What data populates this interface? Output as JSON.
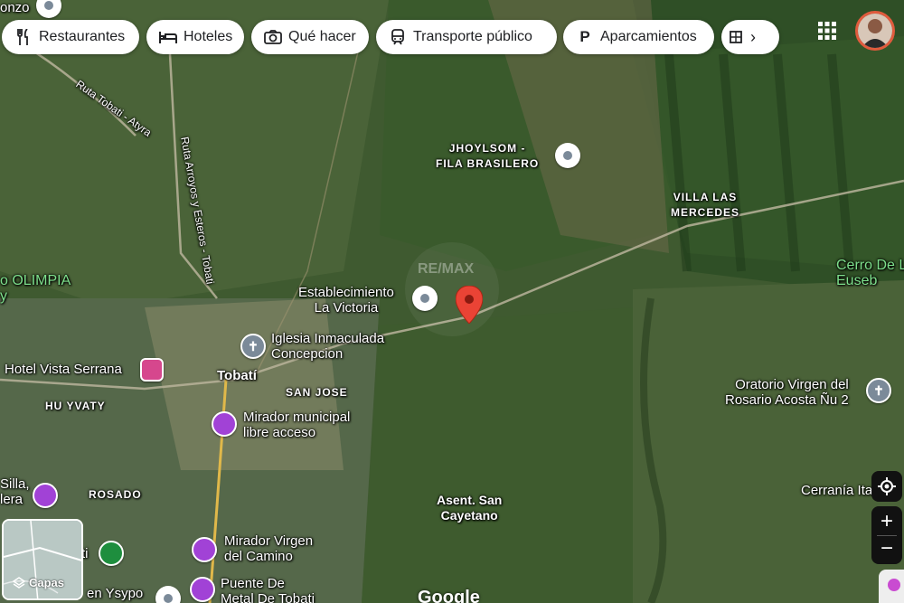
{
  "chips": [
    {
      "label": "Restaurantes",
      "icon": "fork-knife-icon"
    },
    {
      "label": "Hoteles",
      "icon": "bed-icon"
    },
    {
      "label": "Qué hacer",
      "icon": "camera-icon"
    },
    {
      "label": "Transporte público",
      "icon": "train-icon"
    },
    {
      "label": "Aparcamientos",
      "icon": "parking-icon"
    }
  ],
  "top_cut_label": "onzo",
  "labels": {
    "jhoylsom": "JHOYLSOM -\nFILA BRASILERO",
    "villa_las_mercedes": "VILLA LAS\nMERCEDES",
    "cerro": "Cerro De L\nEuseb",
    "olimpia": "o OLIMPIA\ny",
    "establecimiento": "Establecimiento\nLa Victoria",
    "iglesia": "Iglesia Inmaculada\nConcepcion",
    "hotel": "Hotel Vista Serrana",
    "tobati": "Tobatí",
    "san_jose": "SAN JOSE",
    "hu_yvaty": "HU YVATY",
    "mirador_municipal": "Mirador municipal\nlibre acceso",
    "oratorio": "Oratorio Virgen del\nRosario Acosta Ñu 2",
    "silla": "Silla,\nlera",
    "rosado": "ROSADO",
    "asent": "Asent. San\nCayetano",
    "cerrania": "Cerranía Ita",
    "mirador_virgen": "Mirador Virgen\ndel Camino",
    "puente": "Puente De\nMetal De Tobati",
    "en_ysypo": "en Ysypo",
    "ti": "ti",
    "road_tobati_atyra": "Ruta Tobati - Atyra",
    "road_arroyos": "Ruta Arroyos y Esteros - Tobati",
    "watermark": "RE/MAX"
  },
  "layers_label": "Capas",
  "google_label": "Google",
  "colors": {
    "pin_red": "#ea4335",
    "poi_purple": "#a142d6",
    "hotel_pink": "#d6478d"
  }
}
